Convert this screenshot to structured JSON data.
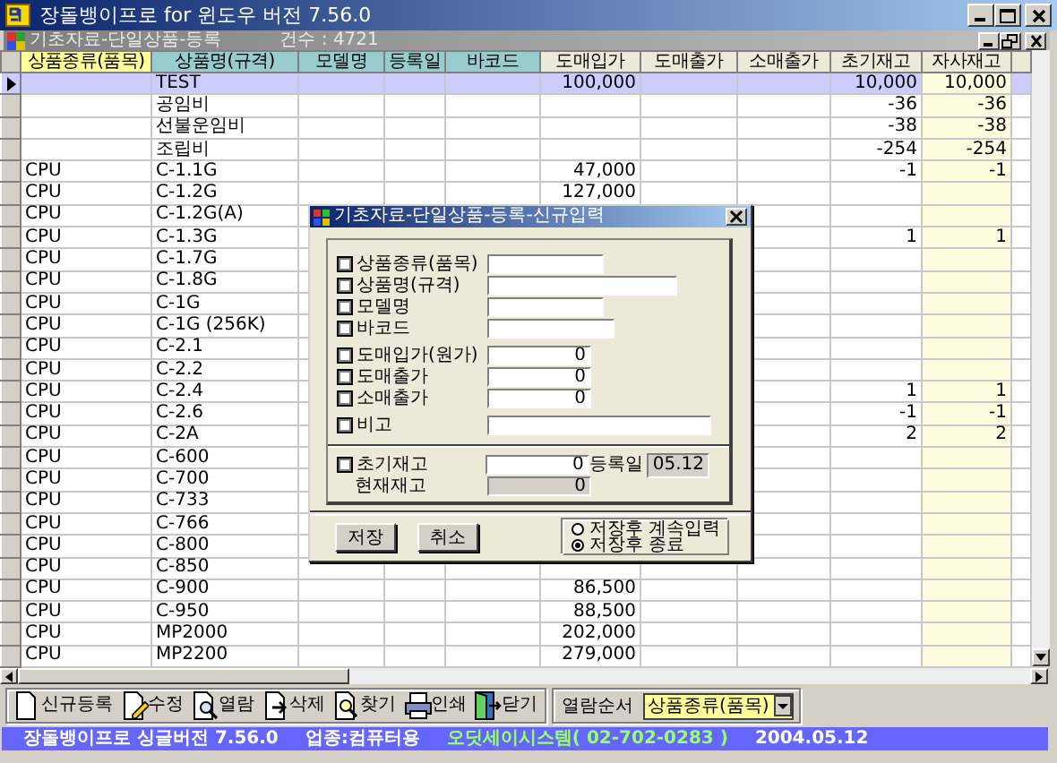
{
  "window": {
    "title": "장돌뱅이프로 for 윈도우 버전 7.56.0"
  },
  "child_window": {
    "title": "기초자료-단일상품-등록",
    "count": "건수 : 4721"
  },
  "table": {
    "columns": [
      {
        "label": "상품종류(품목)",
        "color": "#ffff99"
      },
      {
        "label": "상품명(규격)",
        "color": "#99cccc"
      },
      {
        "label": "모델명",
        "color": "#99cccc"
      },
      {
        "label": "등록일",
        "color": "#99cccc"
      },
      {
        "label": "바코드",
        "color": "#99cccc"
      },
      {
        "label": "도매입가",
        "color": "#ece9d8"
      },
      {
        "label": "도매출가",
        "color": "#ece9d8"
      },
      {
        "label": "소매출가",
        "color": "#ece9d8"
      },
      {
        "label": "초기재고",
        "color": "#ece9d8"
      },
      {
        "label": "자사재고",
        "color": "#ece9d8"
      }
    ],
    "rows": [
      {
        "selected": true,
        "cells": {
          "name": "TEST",
          "buy": "100,000",
          "init": "10,000",
          "own": "10,000"
        }
      },
      {
        "selected": false,
        "cells": {
          "name": "공임비",
          "init": "-36",
          "own": "-36"
        }
      },
      {
        "selected": false,
        "cells": {
          "name": "선불운임비",
          "init": "-38",
          "own": "-38"
        }
      },
      {
        "selected": false,
        "cells": {
          "name": "조립비",
          "init": "-254",
          "own": "-254"
        }
      },
      {
        "selected": false,
        "cells": {
          "type": "CPU",
          "name": "C-1.1G",
          "buy": "47,000",
          "init": "-1",
          "own": "-1"
        }
      },
      {
        "selected": false,
        "cells": {
          "type": "CPU",
          "name": "C-1.2G",
          "buy": "127,000"
        }
      },
      {
        "selected": false,
        "cells": {
          "type": "CPU",
          "name": "C-1.2G(A)"
        }
      },
      {
        "selected": false,
        "cells": {
          "type": "CPU",
          "name": "C-1.3G",
          "init": "1",
          "own": "1"
        }
      },
      {
        "selected": false,
        "cells": {
          "type": "CPU",
          "name": "C-1.7G"
        }
      },
      {
        "selected": false,
        "cells": {
          "type": "CPU",
          "name": "C-1.8G"
        }
      },
      {
        "selected": false,
        "cells": {
          "type": "CPU",
          "name": "C-1G"
        }
      },
      {
        "selected": false,
        "cells": {
          "type": "CPU",
          "name": "C-1G (256K)"
        }
      },
      {
        "selected": false,
        "cells": {
          "type": "CPU",
          "name": "C-2.1"
        }
      },
      {
        "selected": false,
        "cells": {
          "type": "CPU",
          "name": "C-2.2"
        }
      },
      {
        "selected": false,
        "cells": {
          "type": "CPU",
          "name": "C-2.4",
          "init": "1",
          "own": "1"
        }
      },
      {
        "selected": false,
        "cells": {
          "type": "CPU",
          "name": "C-2.6",
          "init": "-1",
          "own": "-1"
        }
      },
      {
        "selected": false,
        "cells": {
          "type": "CPU",
          "name": "C-2A",
          "init": "2",
          "own": "2"
        }
      },
      {
        "selected": false,
        "cells": {
          "type": "CPU",
          "name": "C-600"
        }
      },
      {
        "selected": false,
        "cells": {
          "type": "CPU",
          "name": "C-700"
        }
      },
      {
        "selected": false,
        "cells": {
          "type": "CPU",
          "name": "C-733"
        }
      },
      {
        "selected": false,
        "cells": {
          "type": "CPU",
          "name": "C-766"
        }
      },
      {
        "selected": false,
        "cells": {
          "type": "CPU",
          "name": "C-800"
        }
      },
      {
        "selected": false,
        "cells": {
          "type": "CPU",
          "name": "C-850"
        }
      },
      {
        "selected": false,
        "cells": {
          "type": "CPU",
          "name": "C-900",
          "buy": "86,500"
        }
      },
      {
        "selected": false,
        "cells": {
          "type": "CPU",
          "name": "C-950",
          "buy": "88,500"
        }
      },
      {
        "selected": false,
        "cells": {
          "type": "CPU",
          "name": "MP2000",
          "buy": "202,000"
        }
      },
      {
        "selected": false,
        "cells": {
          "type": "CPU",
          "name": "MP2200",
          "buy": "279,000"
        }
      }
    ]
  },
  "dialog": {
    "title": "기초자료-단일상품-등록-신규입력",
    "fields": [
      {
        "label": "상품종류(품목)",
        "checked": false
      },
      {
        "label": "상품명(규격)",
        "checked": false
      },
      {
        "label": "모델명",
        "checked": false
      },
      {
        "label": "바코드",
        "checked": false
      },
      {
        "label": "도매입가(원가)",
        "checked": false,
        "value": "0"
      },
      {
        "label": "도매출가",
        "checked": false,
        "value": "0"
      },
      {
        "label": "소매출가",
        "checked": false,
        "value": "0"
      },
      {
        "label": "비고",
        "checked": false
      }
    ],
    "stock": [
      {
        "kind": "check",
        "label": "초기재고",
        "checked": false,
        "value": "0",
        "disabled": false
      },
      {
        "kind": "plain",
        "label": "현재재고",
        "value": "0",
        "disabled": true
      }
    ],
    "date": {
      "label": "등록일",
      "value": "05.12"
    },
    "buttons": [
      "저장",
      "취소"
    ],
    "after_save": [
      {
        "label": "저장후 계속입력",
        "selected": false
      },
      {
        "label": "저장후 종료",
        "selected": true
      }
    ]
  },
  "toolbar": {
    "buttons": [
      "신규등록",
      "수정",
      "열람",
      "삭제",
      "찾기",
      "인쇄",
      "닫기"
    ],
    "sort": {
      "label": "열람순서",
      "value": "상품종류(품목)"
    }
  },
  "status_bar": [
    {
      "text": "장돌뱅이프로 싱글버전 7.56.0",
      "kind": "plain"
    },
    {
      "text": "업종:컴퓨터용",
      "kind": "plain"
    },
    {
      "text": "오딧세이시스템( 02-702-0283 )",
      "kind": "vendor"
    },
    {
      "text": "2004.05.12",
      "kind": "plain"
    }
  ]
}
